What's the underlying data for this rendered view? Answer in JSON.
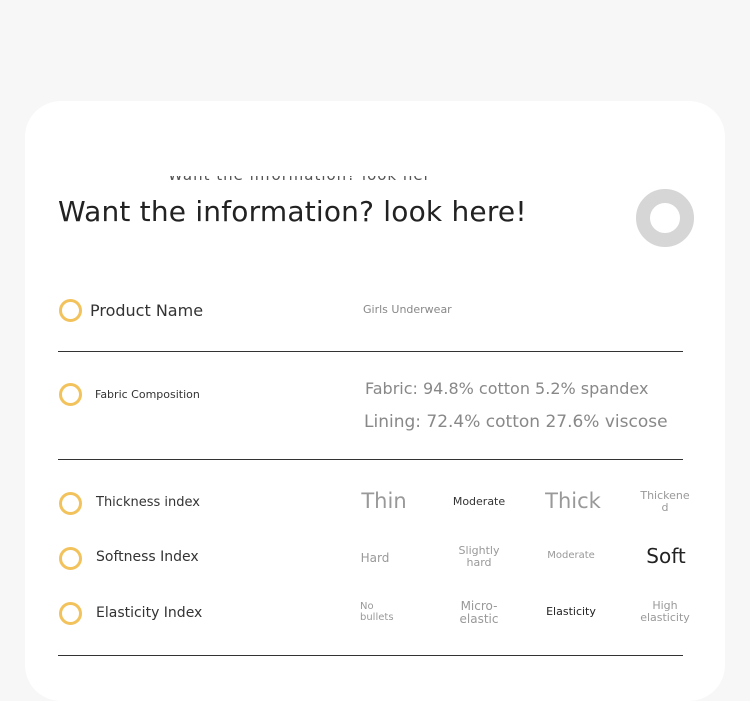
{
  "clipped_heading": "Want the information? look here!",
  "heading": "Want the information? look here!",
  "rows": {
    "product": {
      "label": "Product Name",
      "value": "Girls Underwear"
    },
    "fabric": {
      "label": "Fabric Composition",
      "fabric_line": "Fabric: 94.8% cotton 5.2% spandex",
      "lining_line": "Lining: 72.4% cotton 27.6% viscose"
    },
    "thickness": {
      "label": "Thickness index",
      "options": [
        "Thin",
        "Moderate",
        "Thick",
        "Thickene\nd"
      ]
    },
    "softness": {
      "label": "Softness Index",
      "options": [
        "Hard",
        "Slightly\nhard",
        "Moderate",
        "Soft"
      ]
    },
    "elasticity": {
      "label": "Elasticity Index",
      "options": [
        "No\nbullets",
        "Micro-\nelastic",
        "Elasticity",
        "High\nelasticity"
      ]
    }
  },
  "colors": {
    "accent_ring": "#f2c25c",
    "decor_ring": "#d6d6d6",
    "card": "#ffffff",
    "page": "#f7f7f7"
  }
}
